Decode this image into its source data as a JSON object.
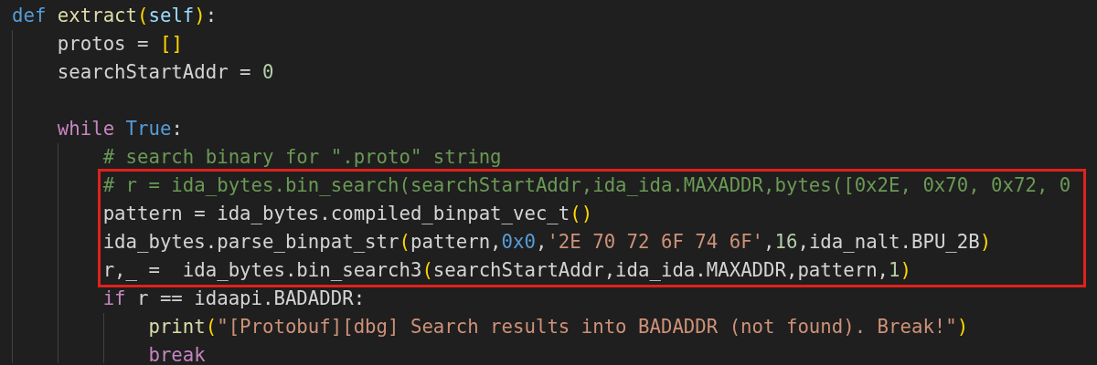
{
  "editor": {
    "lines": [
      {
        "kind": "line",
        "tokens": [
          {
            "kind": "keyword",
            "text": "def "
          },
          {
            "kind": "function",
            "text": "extract"
          },
          {
            "kind": "bracket",
            "text": "("
          },
          {
            "kind": "param",
            "text": "self"
          },
          {
            "kind": "bracket",
            "text": ")"
          },
          {
            "kind": "plain",
            "text": ":"
          }
        ],
        "children": [
          {
            "kind": "line",
            "tokens": [
              {
                "kind": "plain",
                "text": "protos = "
              },
              {
                "kind": "bracket",
                "text": "[]"
              }
            ]
          },
          {
            "kind": "line",
            "tokens": [
              {
                "kind": "plain",
                "text": "searchStartAddr = "
              },
              {
                "kind": "number",
                "text": "0"
              }
            ]
          },
          {
            "kind": "blank"
          },
          {
            "kind": "line",
            "tokens": [
              {
                "kind": "control",
                "text": "while "
              },
              {
                "kind": "keyword",
                "text": "True"
              },
              {
                "kind": "plain",
                "text": ":"
              }
            ],
            "children": [
              {
                "kind": "line",
                "tokens": [
                  {
                    "kind": "comment",
                    "text": "# search binary for \".proto\" string"
                  }
                ]
              },
              {
                "kind": "highlight",
                "children": [
                  {
                    "kind": "line",
                    "tokens": [
                      {
                        "kind": "comment",
                        "text": "# r = ida_bytes.bin_search(searchStartAddr,ida_ida.MAXADDR,bytes([0x2E, 0x70, 0x72, 0"
                      }
                    ]
                  },
                  {
                    "kind": "line",
                    "tokens": [
                      {
                        "kind": "plain",
                        "text": "pattern = ida_bytes.compiled_binpat_vec_t"
                      },
                      {
                        "kind": "bracket",
                        "text": "()"
                      }
                    ]
                  },
                  {
                    "kind": "line",
                    "tokens": [
                      {
                        "kind": "plain",
                        "text": "ida_bytes.parse_binpat_str"
                      },
                      {
                        "kind": "bracket",
                        "text": "("
                      },
                      {
                        "kind": "plain",
                        "text": "pattern,"
                      },
                      {
                        "kind": "keyword",
                        "text": "0x0"
                      },
                      {
                        "kind": "plain",
                        "text": ","
                      },
                      {
                        "kind": "string",
                        "text": "'2E 70 72 6F 74 6F'"
                      },
                      {
                        "kind": "plain",
                        "text": ","
                      },
                      {
                        "kind": "number",
                        "text": "16"
                      },
                      {
                        "kind": "plain",
                        "text": ",ida_nalt.BPU_2B"
                      },
                      {
                        "kind": "bracket",
                        "text": ")"
                      }
                    ]
                  },
                  {
                    "kind": "line",
                    "tokens": [
                      {
                        "kind": "plain",
                        "text": "r,_ =  ida_bytes.bin_search3"
                      },
                      {
                        "kind": "bracket",
                        "text": "("
                      },
                      {
                        "kind": "plain",
                        "text": "searchStartAddr,ida_ida.MAXADDR,pattern,"
                      },
                      {
                        "kind": "number",
                        "text": "1"
                      },
                      {
                        "kind": "bracket",
                        "text": ")"
                      }
                    ]
                  }
                ]
              },
              {
                "kind": "line",
                "tokens": [
                  {
                    "kind": "control",
                    "text": "if"
                  },
                  {
                    "kind": "plain",
                    "text": " r == idaapi.BADADDR:"
                  }
                ],
                "children": [
                  {
                    "kind": "line",
                    "tokens": [
                      {
                        "kind": "function",
                        "text": "print"
                      },
                      {
                        "kind": "bracket",
                        "text": "("
                      },
                      {
                        "kind": "string",
                        "text": "\"[Protobuf][dbg] Search results into BADADDR (not found). Break!\""
                      },
                      {
                        "kind": "bracket",
                        "text": ")"
                      }
                    ]
                  },
                  {
                    "kind": "line",
                    "tokens": [
                      {
                        "kind": "control",
                        "text": "break"
                      }
                    ]
                  }
                ]
              }
            ]
          }
        ]
      }
    ]
  }
}
